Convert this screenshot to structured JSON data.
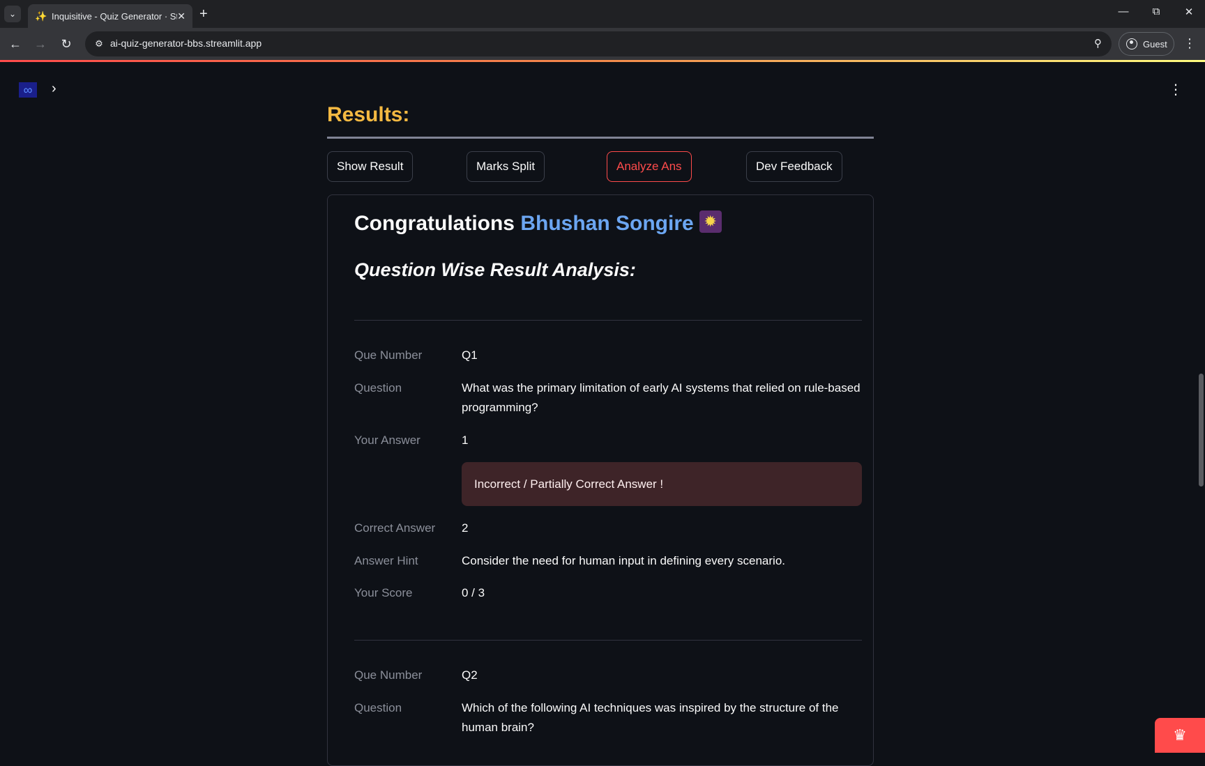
{
  "browser": {
    "tab_title": "Inquisitive - Quiz Generator · St",
    "tab_favicon": "sparkles-icon",
    "url": "ai-quiz-generator-bbs.streamlit.app",
    "profile_label": "Guest"
  },
  "app": {
    "logo_icon": "infinity-icon",
    "results_heading": "Results:",
    "tabs": [
      {
        "label": "Show Result",
        "active": false
      },
      {
        "label": "Marks Split",
        "active": false
      },
      {
        "label": "Analyze Ans",
        "active": true
      },
      {
        "label": "Dev Feedback",
        "active": false
      }
    ],
    "congrats_prefix": "Congratulations",
    "user_name": "Bhushan Songire",
    "congrats_emoji": "fireworks-emoji",
    "analysis_title": "Question Wise Result Analysis:",
    "labels": {
      "que_number": "Que Number",
      "question": "Question",
      "your_answer": "Your Answer",
      "correct_answer": "Correct Answer",
      "answer_hint": "Answer Hint",
      "your_score": "Your Score"
    },
    "questions": [
      {
        "que_number": "Q1",
        "question": "What was the primary limitation of early AI systems that relied on rule-based programming?",
        "your_answer": "1",
        "status": "Incorrect / Partially Correct Answer !",
        "correct_answer": "2",
        "answer_hint": "Consider the need for human input in defining every scenario.",
        "your_score": "0 / 3"
      },
      {
        "que_number": "Q2",
        "question": "Which of the following AI techniques was inspired by the structure of the human brain?"
      }
    ]
  },
  "colors": {
    "background": "#0e1117",
    "heading_accent": "#f4b942",
    "user_name": "#6ca6f2",
    "active_tab": "#ff4b4b",
    "error_box": "#3e2428"
  }
}
